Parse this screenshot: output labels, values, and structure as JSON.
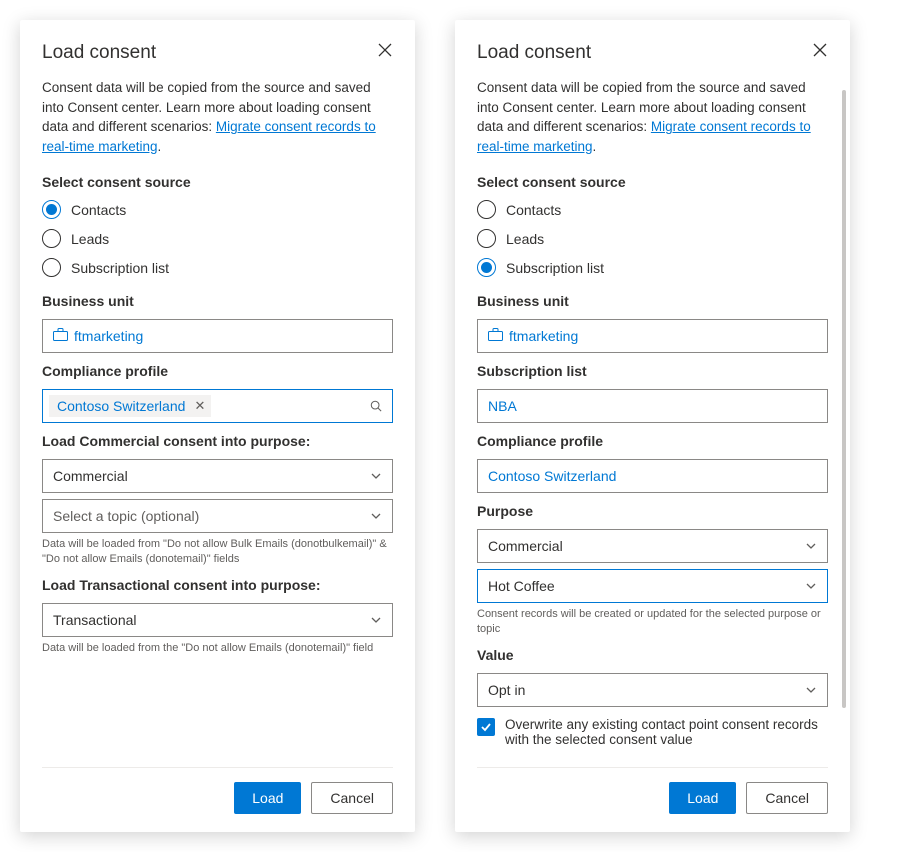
{
  "common": {
    "title": "Load consent",
    "desc_prefix": "Consent data will be copied from the source and saved into Consent center. Learn more about loading consent data and different scenarios: ",
    "link_text": "Migrate consent records to real-time marketing",
    "select_source_label": "Select consent source",
    "radio_contacts": "Contacts",
    "radio_leads": "Leads",
    "radio_sublist": "Subscription list",
    "business_unit_label": "Business unit",
    "business_unit_value": "ftmarketing",
    "compliance_profile_label": "Compliance profile",
    "compliance_profile_value": "Contoso Switzerland",
    "load_label": "Load",
    "cancel_label": "Cancel"
  },
  "left": {
    "commercial_label": "Load Commercial consent into purpose:",
    "commercial_value": "Commercial",
    "topic_placeholder": "Select a topic (optional)",
    "commercial_helper": "Data will be loaded from \"Do not allow Bulk Emails (donotbulkemail)\" & \"Do not allow Emails (donotemail)\" fields",
    "transactional_label": "Load Transactional consent into purpose:",
    "transactional_value": "Transactional",
    "transactional_helper": "Data will be loaded from the \"Do not allow Emails (donotemail)\" field"
  },
  "right": {
    "sublist_label": "Subscription list",
    "sublist_value": "NBA",
    "purpose_label": "Purpose",
    "purpose_value": "Commercial",
    "topic_value": "Hot Coffee",
    "purpose_helper": "Consent records will be created or updated for the selected purpose or topic",
    "value_label": "Value",
    "value_value": "Opt in",
    "checkbox_label": "Overwrite any existing contact point consent records with the selected consent value"
  }
}
